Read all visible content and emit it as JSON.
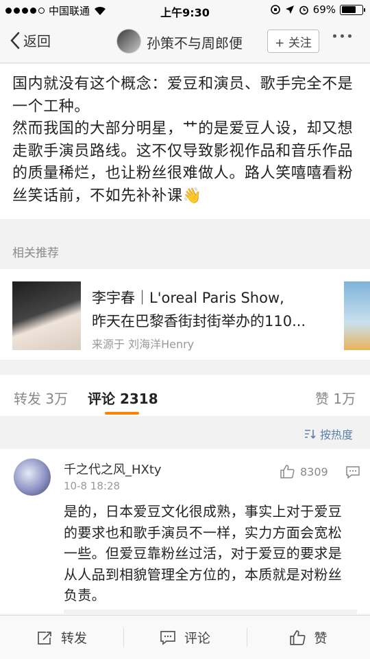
{
  "status_bar": {
    "carrier": "中国联通",
    "time": "上午9:30",
    "battery_percent": "69%",
    "battery_level": 0.69
  },
  "nav": {
    "back_label": "返回",
    "title": "孙策不与周郎便",
    "follow_label": "+ 关注"
  },
  "post": {
    "paragraphs": [
      "国内就没有这个概念：爱豆和演员、歌手完全不是一个工种。",
      "然而我国的大部分明星，艹的是爱豆人设，却又想走歌手演员路线。这不仅导致影视作品和音乐作品的质量稀烂，也让粉丝很难做人。路人笑嘻嘻看粉丝笑话前，不如先补补课👋"
    ]
  },
  "related": {
    "label": "相关推荐",
    "item": {
      "title_line1": "李宇春｜L'oreal Paris Show,",
      "title_line2": "昨天在巴黎香街封街举办的110...",
      "source": "来源于 刘海洋Henry"
    }
  },
  "tabs": {
    "repost": "转发 3万",
    "comments": "评论 2318",
    "likes": "赞 1万"
  },
  "sort_label": "按热度",
  "comment": {
    "user": "千之代之风_HXty",
    "time": "10-8 18:28",
    "likes": "8309",
    "text": "是的，日本爱豆文化很成熟，事实上对于爱豆的要求也和歌手演员不一样，实力方面会宽松一些。但爱豆靠粉丝过活，对于爱豆的要求是从人品到相貌管理全方位的，本质就是对粉丝负责。"
  },
  "bottom_bar": {
    "repost": "转发",
    "comment": "评论",
    "like": "赞"
  },
  "colors": {
    "accent": "#ff8200",
    "link": "#5b7fa6"
  }
}
